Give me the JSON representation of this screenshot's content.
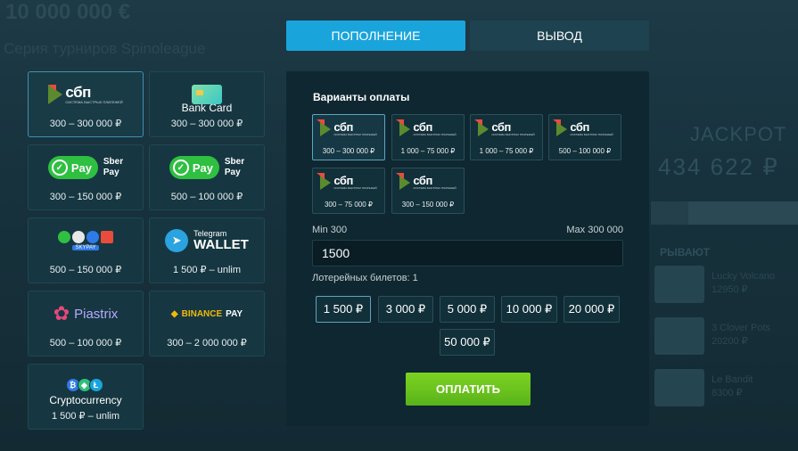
{
  "background": {
    "big_amount": "10 000 000 €",
    "tournament_series": "Серия турниров Spinoleague",
    "jackpot_label": "JACKPOT",
    "jackpot_amount": "434 622 ₽",
    "wins_label": "РЫВАЮТ",
    "wins": [
      {
        "game": "Lucky Volcano",
        "amount": "12950 ₽"
      },
      {
        "game": "3 Clover Pots",
        "amount": "20200 ₽"
      },
      {
        "game": "Le Bandit",
        "amount": "8300 ₽"
      }
    ]
  },
  "methods": [
    {
      "id": "sbp",
      "name": "",
      "range": "300 – 300 000 ₽",
      "active": true
    },
    {
      "id": "bank-card",
      "name": "Bank Card",
      "range": "300 – 300 000 ₽",
      "active": false
    },
    {
      "id": "sber-pay-1",
      "name": "",
      "range": "300 – 150 000 ₽",
      "active": false
    },
    {
      "id": "sber-pay-2",
      "name": "",
      "range": "500 – 100 000 ₽",
      "active": false
    },
    {
      "id": "skypay",
      "name": "",
      "range": "500 – 150 000 ₽",
      "active": false
    },
    {
      "id": "telegram-wallet",
      "name": "",
      "range": "1 500 ₽ – unlim",
      "active": false
    },
    {
      "id": "piastrix",
      "name": "",
      "range": "500 – 100 000 ₽",
      "active": false
    },
    {
      "id": "binance-pay",
      "name": "",
      "range": "300 – 2 000 000 ₽",
      "active": false
    },
    {
      "id": "cryptocurrency",
      "name": "Cryptocurrency",
      "range": "1 500 ₽ – unlim",
      "active": false
    }
  ],
  "logos": {
    "sbp_text": "сбп",
    "sbp_small": "СИСТЕМА БЫСТРЫХ ПЛАТЕЖЕЙ",
    "sber_pill": "Pay",
    "sber_side_1": "Sber",
    "sber_side_2": "Pay",
    "skypay_text": "SKYPAY",
    "telegram_line1": "Telegram",
    "telegram_line2": "WALLET",
    "piastrix_text": "Piastrix",
    "binance_text": "BINANCE",
    "binance_pay": "PAY"
  },
  "tabs": {
    "deposit": "ПОПОЛНЕНИЕ",
    "withdraw": "ВЫВОД"
  },
  "panel": {
    "title": "Варианты оплаты",
    "options": [
      {
        "range": "300 – 300 000 ₽",
        "active": true
      },
      {
        "range": "1 000 – 75 000 ₽",
        "active": false
      },
      {
        "range": "1 000 – 75 000 ₽",
        "active": false
      },
      {
        "range": "500 – 100 000 ₽",
        "active": false
      },
      {
        "range": "300 – 75 000 ₽",
        "active": false
      },
      {
        "range": "300 – 150 000 ₽",
        "active": false
      }
    ],
    "min_label": "Min 300",
    "max_label": "Max 300 000",
    "amount_value": "1500",
    "tickets_label": "Лотерейных билетов: 1",
    "quick_amounts": [
      "1 500 ₽",
      "3 000 ₽",
      "5 000 ₽",
      "10 000 ₽",
      "20 000 ₽",
      "50 000 ₽"
    ],
    "quick_selected": "1 500 ₽",
    "pay_button": "ОПЛАТИТЬ"
  },
  "colors": {
    "accent": "#1aa4dc",
    "pay_green": "#7ed321",
    "panel_bg": "#0f2730"
  }
}
